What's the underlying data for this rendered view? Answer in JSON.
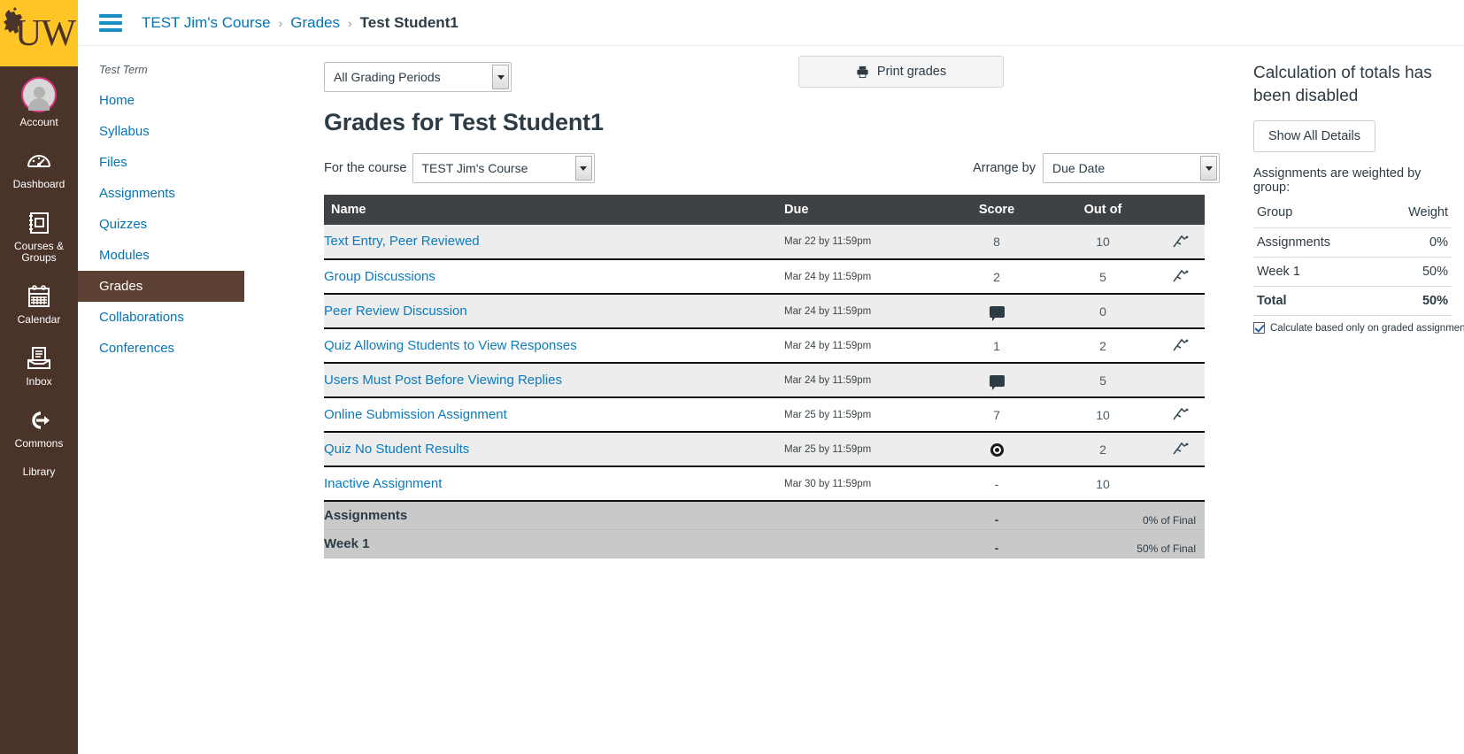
{
  "global_nav": {
    "logo_text": "UW",
    "logo_icon": "bucking-horse-icon",
    "items": [
      {
        "label": "Account",
        "icon": "user-avatar-icon"
      },
      {
        "label": "Dashboard",
        "icon": "dashboard-gauge-icon"
      },
      {
        "label": "Courses & Groups",
        "icon": "courses-book-icon"
      },
      {
        "label": "Calendar",
        "icon": "calendar-icon"
      },
      {
        "label": "Inbox",
        "icon": "inbox-tray-icon"
      },
      {
        "label": "Commons",
        "icon": "commons-arrow-icon"
      },
      {
        "label": "Library",
        "icon": ""
      }
    ]
  },
  "header": {
    "menu_icon": "hamburger-menu-icon",
    "breadcrumb": [
      {
        "label": "TEST Jim's Course",
        "is_link": true
      },
      {
        "label": "Grades",
        "is_link": true
      },
      {
        "label": "Test Student1",
        "is_link": false
      }
    ],
    "separator": "›"
  },
  "course_nav": {
    "term": "Test Term",
    "items": [
      {
        "label": "Home",
        "active": false
      },
      {
        "label": "Syllabus",
        "active": false
      },
      {
        "label": "Files",
        "active": false
      },
      {
        "label": "Assignments",
        "active": false
      },
      {
        "label": "Quizzes",
        "active": false
      },
      {
        "label": "Modules",
        "active": false
      },
      {
        "label": "Grades",
        "active": true
      },
      {
        "label": "Collaborations",
        "active": false
      },
      {
        "label": "Conferences",
        "active": false
      }
    ]
  },
  "main": {
    "grading_period": {
      "value": "All Grading Periods"
    },
    "print_button": {
      "label": "Print grades",
      "icon": "printer-icon"
    },
    "page_title": "Grades for Test Student1",
    "for_the_course_label": "For the course",
    "course_select": {
      "value": "TEST Jim's Course"
    },
    "arrange_by_label": "Arrange by",
    "arrange_select": {
      "value": "Due Date"
    },
    "table": {
      "columns": [
        "Name",
        "Due",
        "Score",
        "Out of"
      ],
      "rows": [
        {
          "name": "Text Entry, Peer Reviewed",
          "due": "Mar 22 by 11:59pm",
          "score": "8",
          "score_icon": "",
          "out_of": "10",
          "row_icon": "rubric-icon"
        },
        {
          "name": "Group Discussions",
          "due": "Mar 24 by 11:59pm",
          "score": "2",
          "score_icon": "",
          "out_of": "5",
          "row_icon": "rubric-icon"
        },
        {
          "name": "Peer Review Discussion",
          "due": "Mar 24 by 11:59pm",
          "score": "",
          "score_icon": "comment-bubble-icon",
          "out_of": "0",
          "row_icon": ""
        },
        {
          "name": "Quiz Allowing Students to View Responses",
          "due": "Mar 24 by 11:59pm",
          "score": "1",
          "score_icon": "",
          "out_of": "2",
          "row_icon": "rubric-icon"
        },
        {
          "name": "Users Must Post Before Viewing Replies",
          "due": "Mar 24 by 11:59pm",
          "score": "",
          "score_icon": "comment-bubble-icon",
          "out_of": "5",
          "row_icon": ""
        },
        {
          "name": "Online Submission Assignment",
          "due": "Mar 25 by 11:59pm",
          "score": "7",
          "score_icon": "",
          "out_of": "10",
          "row_icon": "rubric-icon"
        },
        {
          "name": "Quiz No Student Results",
          "due": "Mar 25 by 11:59pm",
          "score": "",
          "score_icon": "quiz-blocked-icon",
          "out_of": "2",
          "row_icon": "rubric-icon"
        },
        {
          "name": "Inactive Assignment",
          "due": "Mar 30 by 11:59pm",
          "score": "-",
          "score_icon": "",
          "out_of": "10",
          "row_icon": ""
        }
      ],
      "group_rows": [
        {
          "name": "Assignments",
          "score": "-",
          "final": "0% of Final"
        },
        {
          "name": "Week 1",
          "score": "-",
          "final": "50% of Final"
        }
      ]
    }
  },
  "sidebar": {
    "heading": "Calculation of totals has been disabled",
    "show_details_button": "Show All Details",
    "weight_note": "Assignments are weighted by group:",
    "weight_table": {
      "columns": [
        "Group",
        "Weight"
      ],
      "rows": [
        {
          "group": "Assignments",
          "weight": "0%",
          "is_total": false
        },
        {
          "group": "Week 1",
          "weight": "50%",
          "is_total": false
        },
        {
          "group": "Total",
          "weight": "50%",
          "is_total": true
        }
      ]
    },
    "calc_checkbox": {
      "label": "Calculate based only on graded assignments",
      "checked": true
    }
  },
  "colors": {
    "brand_gold": "#ffc425",
    "brand_brown": "#4a342a",
    "nav_active": "#5c4033",
    "link_blue": "#0374b5",
    "table_header": "#3f4245",
    "group_row": "#c9c9c9"
  }
}
